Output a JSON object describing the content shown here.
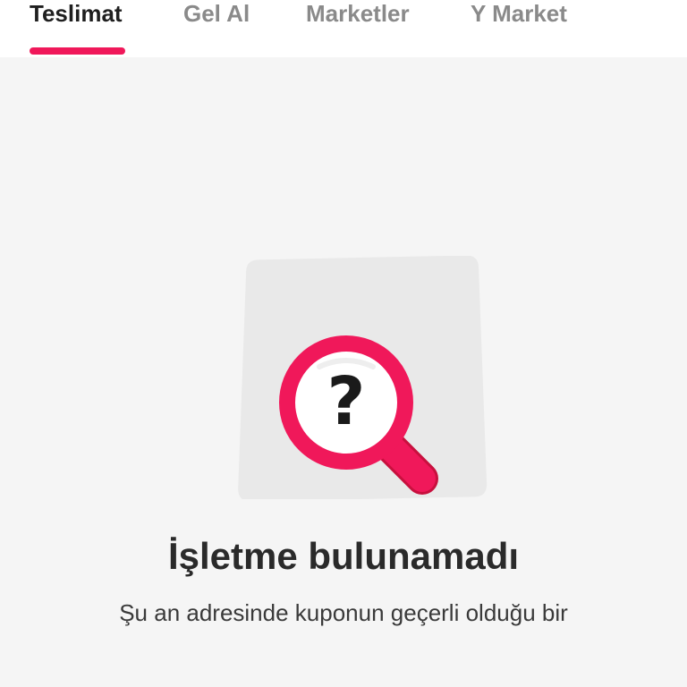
{
  "tabs": [
    {
      "label": "Teslimat",
      "active": true
    },
    {
      "label": "Gel Al",
      "active": false
    },
    {
      "label": "Marketler",
      "active": false
    },
    {
      "label": "Y Market",
      "active": false
    }
  ],
  "empty_state": {
    "icon": "magnifier-question-icon",
    "title": "İşletme bulunamadı",
    "description": "Şu an adresinde kuponun geçerli olduğu bir"
  },
  "colors": {
    "accent": "#f0185a",
    "background": "#f5f5f5",
    "card": "#e9e9e9",
    "text_dark": "#1f1f1f",
    "text_muted": "#8a8a8a"
  }
}
